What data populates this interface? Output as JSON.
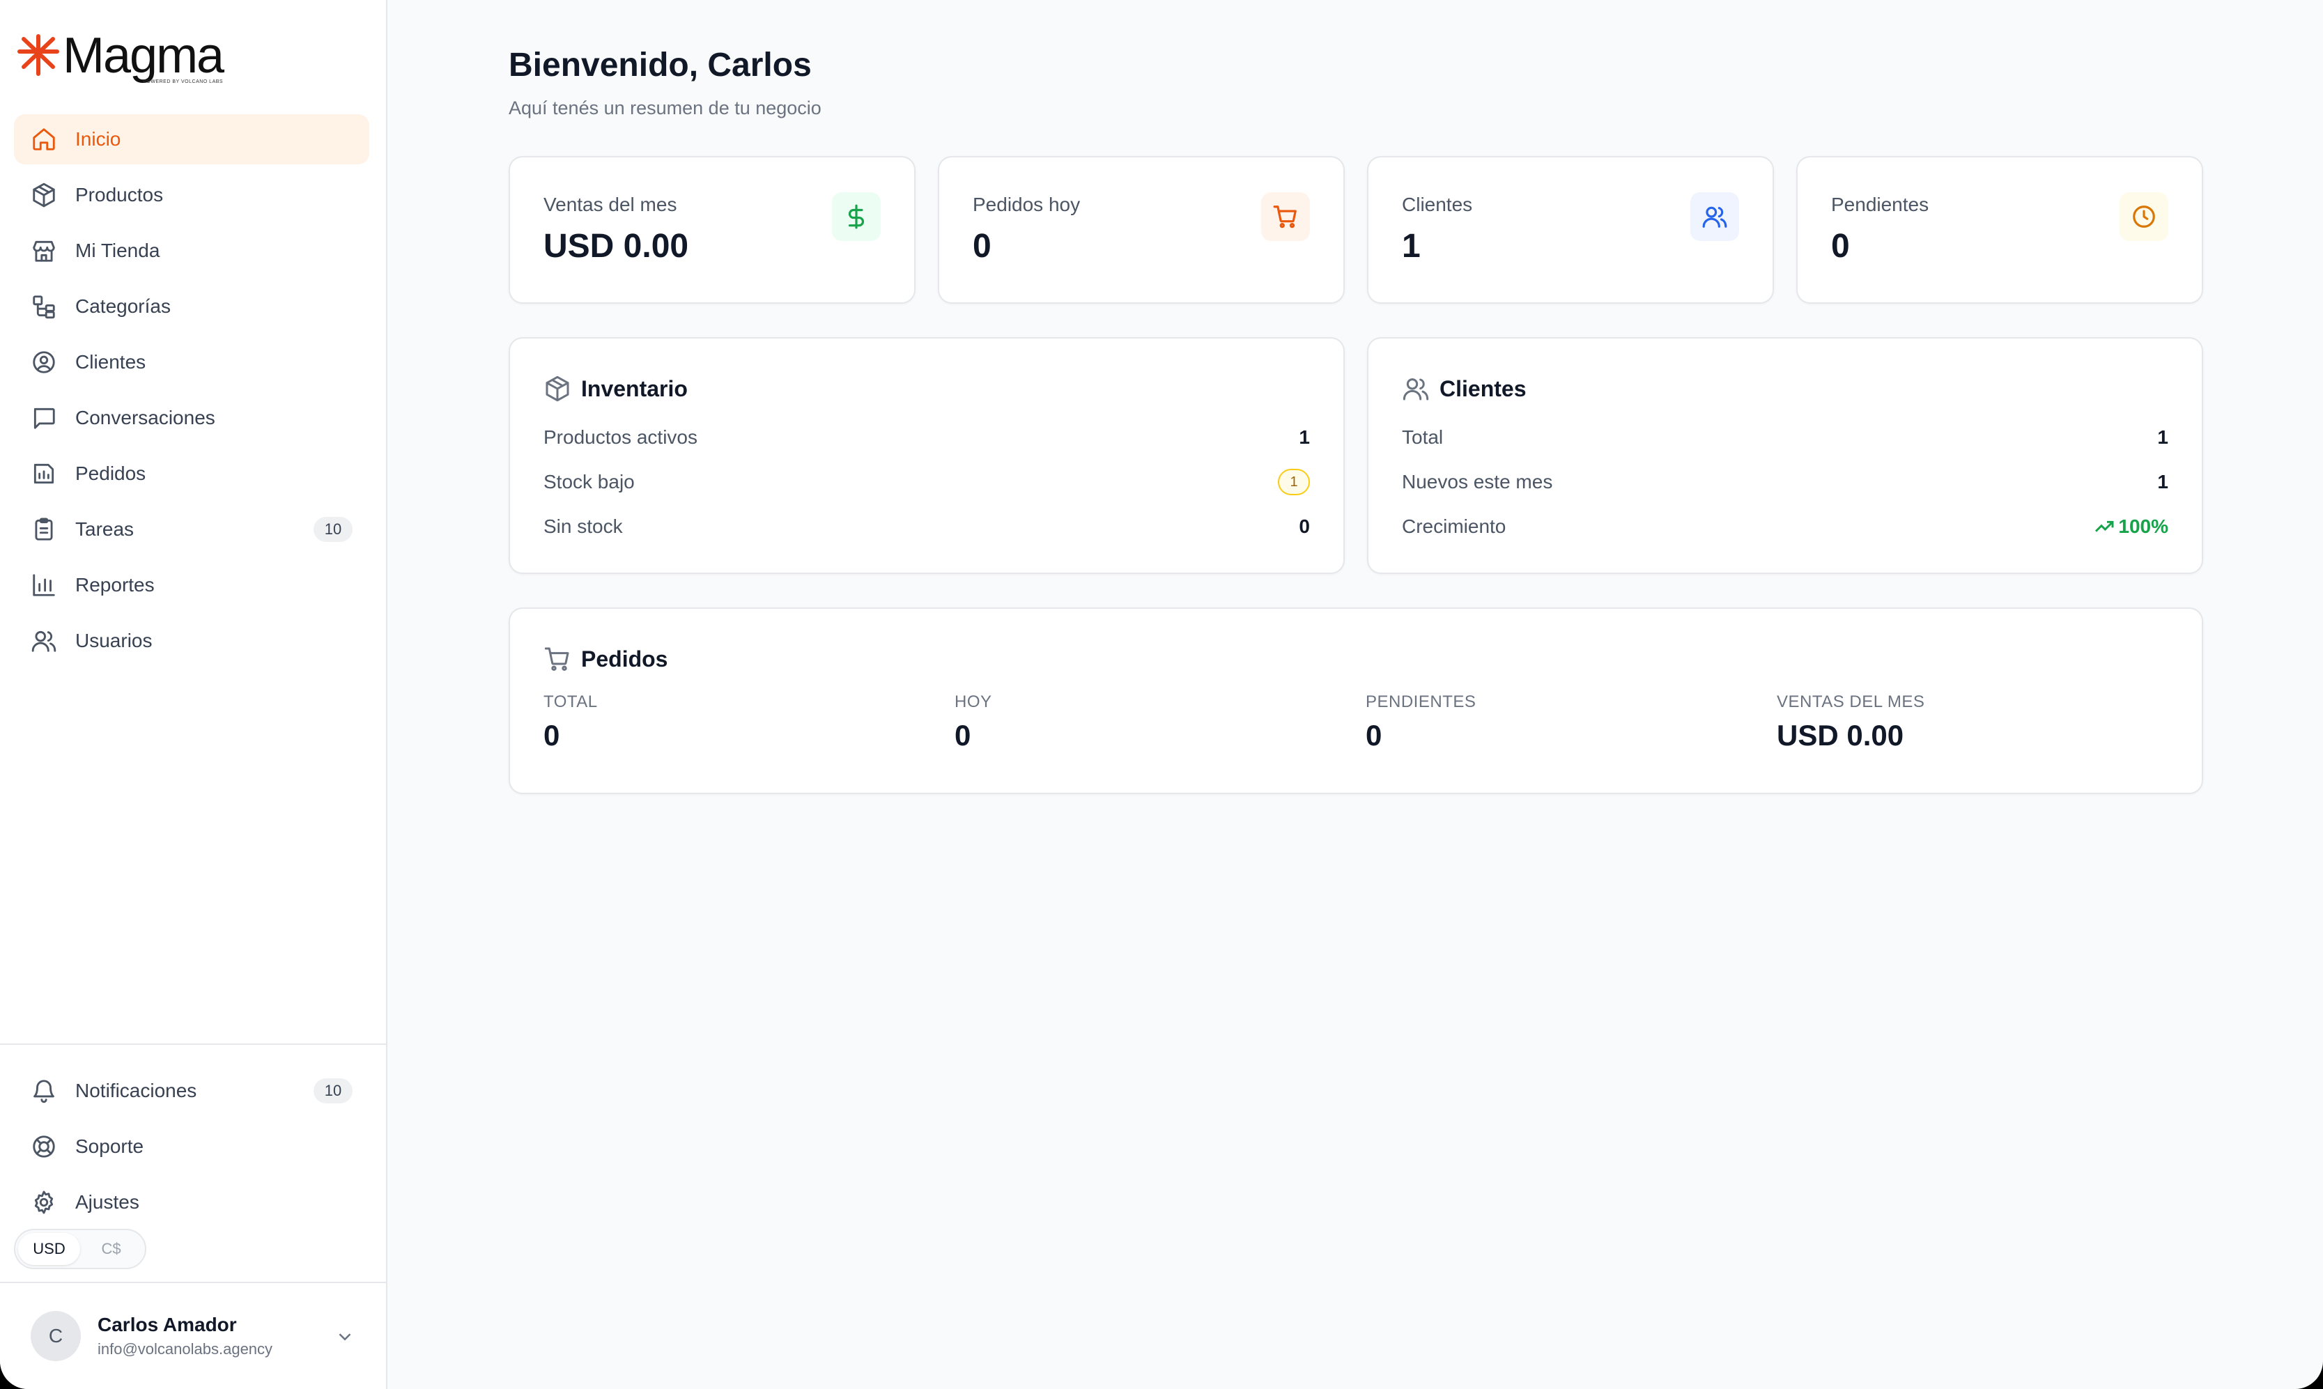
{
  "brand": {
    "name": "Magma",
    "tagline": "Powered by Volcano Labs",
    "accent": "#ea580c"
  },
  "sidebar": {
    "items": [
      {
        "label": "Inicio",
        "icon": "home-icon",
        "active": true
      },
      {
        "label": "Productos",
        "icon": "package-icon"
      },
      {
        "label": "Mi Tienda",
        "icon": "store-icon"
      },
      {
        "label": "Categorías",
        "icon": "categories-icon"
      },
      {
        "label": "Clientes",
        "icon": "user-circle-icon"
      },
      {
        "label": "Conversaciones",
        "icon": "chat-icon"
      },
      {
        "label": "Pedidos",
        "icon": "orders-icon"
      },
      {
        "label": "Tareas",
        "icon": "clipboard-icon",
        "badge": "10"
      },
      {
        "label": "Reportes",
        "icon": "bar-chart-icon"
      },
      {
        "label": "Usuarios",
        "icon": "users-icon"
      }
    ],
    "bottom": [
      {
        "label": "Notificaciones",
        "icon": "bell-icon",
        "badge": "10"
      },
      {
        "label": "Soporte",
        "icon": "lifebuoy-icon"
      },
      {
        "label": "Ajustes",
        "icon": "gear-icon"
      }
    ],
    "currency": {
      "options": [
        "USD",
        "C$"
      ],
      "selected": "USD"
    },
    "user": {
      "initial": "C",
      "name": "Carlos Amador",
      "email": "info@volcanolabs.agency"
    }
  },
  "main": {
    "title": "Bienvenido, Carlos",
    "subtitle": "Aquí tenés un resumen de tu negocio",
    "stats": [
      {
        "label": "Ventas del mes",
        "value": "USD 0.00",
        "icon": "dollar-icon",
        "color": "#16a34a",
        "bg": "#ecfdf3"
      },
      {
        "label": "Pedidos hoy",
        "value": "0",
        "icon": "cart-icon",
        "color": "#ea580c",
        "bg": "#fff4ec"
      },
      {
        "label": "Clientes",
        "value": "1",
        "icon": "users-icon",
        "color": "#2563eb",
        "bg": "#eff4ff"
      },
      {
        "label": "Pendientes",
        "value": "0",
        "icon": "clock-icon",
        "color": "#d97706",
        "bg": "#fffbeb"
      }
    ],
    "inventory": {
      "title": "Inventario",
      "rows": [
        {
          "label": "Productos activos",
          "value": "1"
        },
        {
          "label": "Stock bajo",
          "value": "1"
        },
        {
          "label": "Sin stock",
          "value": "0"
        }
      ]
    },
    "clients": {
      "title": "Clientes",
      "rows": [
        {
          "label": "Total",
          "value": "1"
        },
        {
          "label": "Nuevos este mes",
          "value": "1"
        },
        {
          "label": "Crecimiento",
          "value": "100%"
        }
      ]
    },
    "orders": {
      "title": "Pedidos",
      "cols": [
        {
          "label": "Total",
          "value": "0"
        },
        {
          "label": "Hoy",
          "value": "0"
        },
        {
          "label": "Pendientes",
          "value": "0"
        },
        {
          "label": "Ventas del mes",
          "value": "USD 0.00"
        }
      ]
    }
  }
}
